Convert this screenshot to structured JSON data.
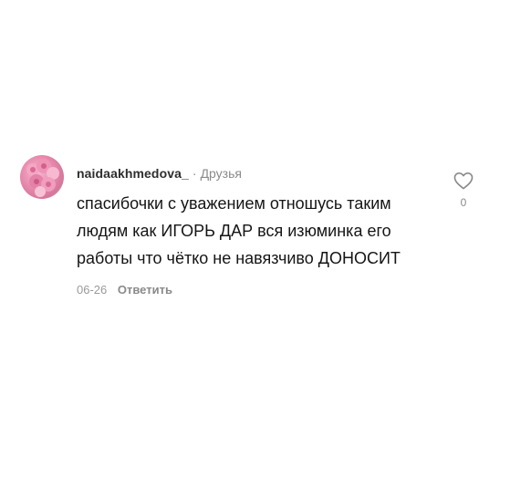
{
  "comment": {
    "username": "naidaakhmedova_",
    "separator": "·",
    "badge": "Друзья",
    "text": "спасибочки с уважением отношусь таким людям как ИГОРЬ ДАР вся изюминка его работы что чётко не навязчиво ДОНОСИТ",
    "date": "06-26",
    "reply_label": "Ответить",
    "like_count": "0",
    "avatar_icon": "flower-bouquet-icon",
    "like_icon": "heart-outline-icon"
  },
  "colors": {
    "username": "#2e2e2e",
    "muted": "#8a8a8a",
    "text": "#151515",
    "avatar_pink": "#e789ac"
  }
}
